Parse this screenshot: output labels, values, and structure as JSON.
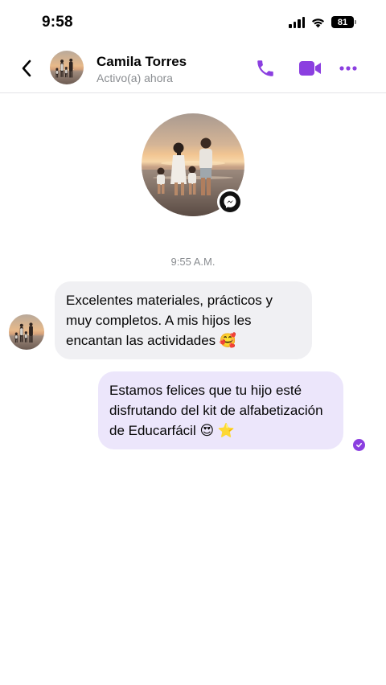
{
  "status_bar": {
    "time": "9:58",
    "battery": "81"
  },
  "header": {
    "contact_name": "Camila Torres",
    "contact_status": "Activo(a) ahora"
  },
  "conversation": {
    "timestamp": "9:55 A.M.",
    "messages": [
      {
        "direction": "incoming",
        "text": "Excelentes materiales, prácticos y muy completos. A mis hijos les encantan las actividades 🥰"
      },
      {
        "direction": "outgoing",
        "text": "Estamos felices que tu hijo esté disfrutando del kit de alfabetización de Educarfácil 😍 ⭐"
      }
    ]
  },
  "icons": {
    "back": "chevron-left-icon",
    "call": "phone-icon",
    "video": "video-camera-icon",
    "more": "more-dots-icon",
    "badge": "messenger-icon",
    "read": "check-circle-icon"
  },
  "colors": {
    "accent": "#8b3fe0",
    "outgoing_bubble": "#ece6fb",
    "incoming_bubble": "#f0f0f3",
    "muted_text": "#8a8d91"
  }
}
